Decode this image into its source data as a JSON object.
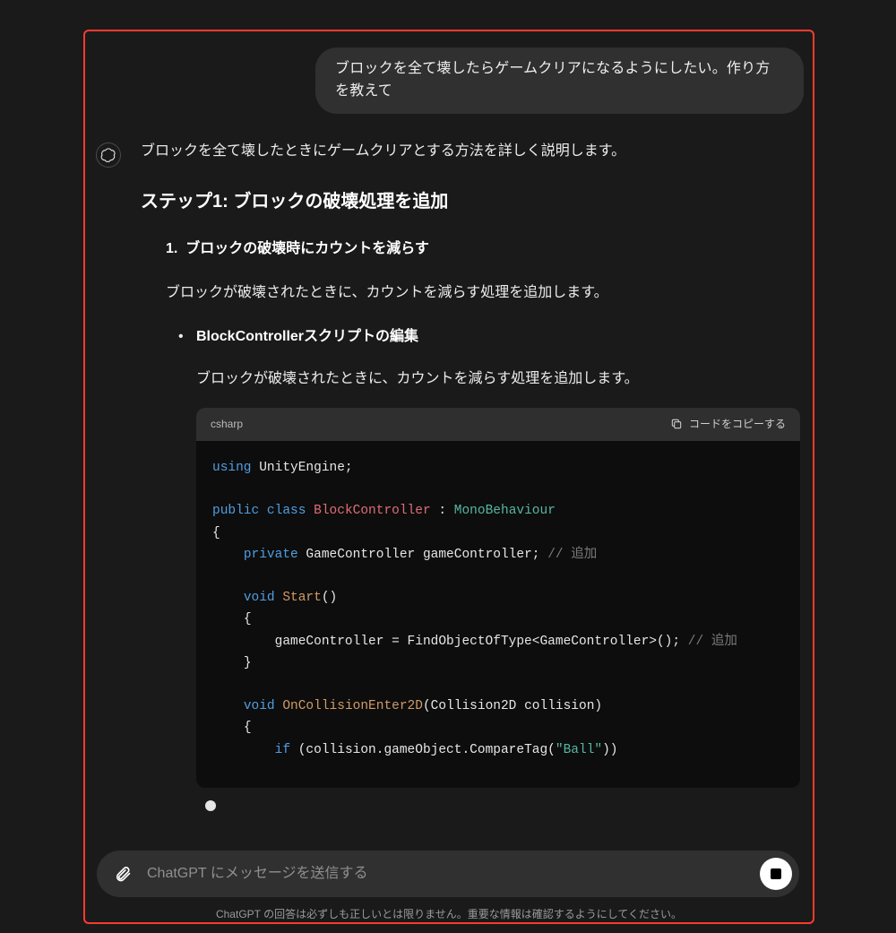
{
  "user_message": "ブロックを全て壊したらゲームクリアになるようにしたい。作り方を教えて",
  "assistant": {
    "intro": "ブロックを全て壊したときにゲームクリアとする方法を詳しく説明します。",
    "step_heading": "ステップ1: ブロックの破壊処理を追加",
    "ol_marker": "1.",
    "ol_title": "ブロックの破壊時にカウントを減らす",
    "ol_desc": "ブロックが破壊されたときに、カウントを減らす処理を追加します。",
    "ul_title": "BlockControllerスクリプトの編集",
    "ul_desc": "ブロックが破壊されたときに、カウントを減らす処理を追加します。"
  },
  "code": {
    "lang_label": "csharp",
    "copy_label": "コードをコピーする",
    "tokens": {
      "using": "using",
      "unityengine": " UnityEngine;",
      "public": "public",
      "class": "class",
      "blockcontroller": "BlockController",
      "colon": " : ",
      "monobehaviour": "MonoBehaviour",
      "lbrace": "{",
      "rbrace": "}",
      "private": "private",
      "gc_decl": " GameController gameController; ",
      "cmt_add": "// 追加",
      "void": "void",
      "start": "Start",
      "parens": "()",
      "gc_assign": "        gameController = FindObjectOfType<GameController>(); ",
      "oncollision": "OnCollisionEnter2D",
      "collision_params": "(Collision2D collision)",
      "if": "if",
      "if_cond_open": " (collision.gameObject.CompareTag(",
      "ball_str": "\"Ball\"",
      "if_cond_close": "))"
    }
  },
  "composer": {
    "placeholder": "ChatGPT にメッセージを送信する"
  },
  "disclaimer": "ChatGPT の回答は必ずしも正しいとは限りません。重要な情報は確認するようにしてください。"
}
